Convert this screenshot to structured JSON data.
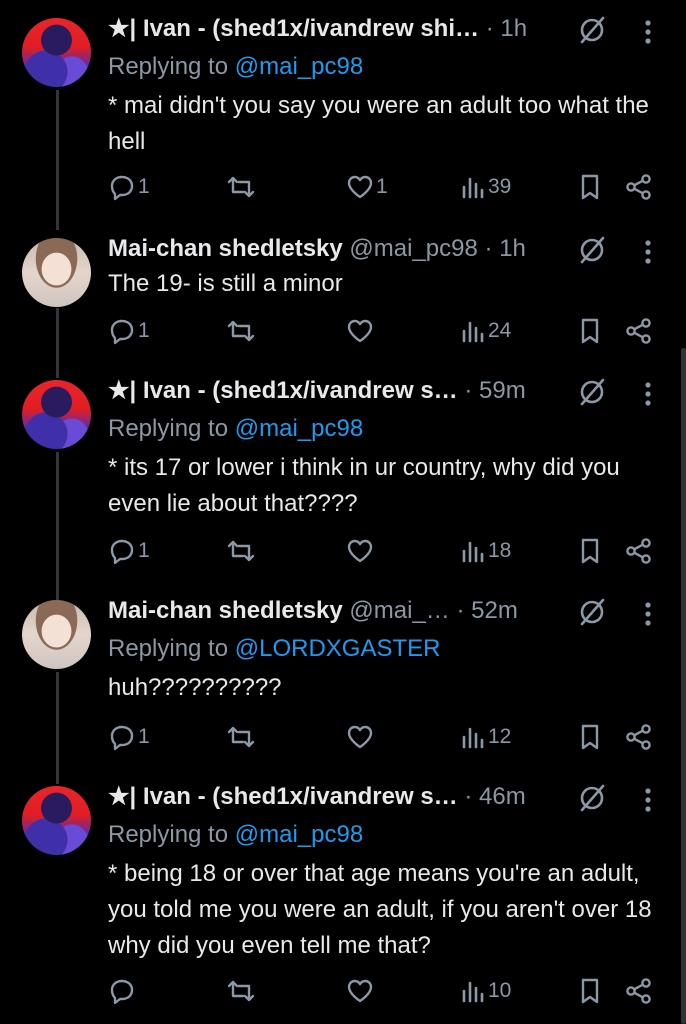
{
  "tweets": [
    {
      "avatar": "ivan-avatar",
      "name": "★| Ivan - (shed1x/ivandrew shi…",
      "handle": "",
      "time": "1h",
      "reply_prefix": "Replying to ",
      "reply_to": "@mai_pc98",
      "text": "* mai didn't you say you were an adult too what the hell",
      "replies": "1",
      "reposts": "",
      "likes": "1",
      "views": "39"
    },
    {
      "avatar": "mai-avatar",
      "name": "Mai-chan shedletsky",
      "handle": "@mai_pc98",
      "time": "1h",
      "reply_prefix": "",
      "reply_to": "",
      "text": "The 19- is still a minor",
      "replies": "1",
      "reposts": "",
      "likes": "",
      "views": "24"
    },
    {
      "avatar": "ivan-avatar",
      "name": "★| Ivan - (shed1x/ivandrew s…",
      "handle": "",
      "time": "59m",
      "reply_prefix": "Replying to ",
      "reply_to": "@mai_pc98",
      "text": "* its 17 or lower i think in ur country, why did you even lie about that????",
      "replies": "1",
      "reposts": "",
      "likes": "",
      "views": "18"
    },
    {
      "avatar": "mai-avatar",
      "name": "Mai-chan shedletsky",
      "handle": "@mai_…",
      "time": "52m",
      "reply_prefix": "Replying to ",
      "reply_to": "@LORDXGASTER",
      "text": "huh??????????",
      "replies": "1",
      "reposts": "",
      "likes": "",
      "views": "12"
    },
    {
      "avatar": "ivan-avatar",
      "name": "★| Ivan - (shed1x/ivandrew s…",
      "handle": "",
      "time": "46m",
      "reply_prefix": "Replying to ",
      "reply_to": "@mai_pc98",
      "text": "* being 18 or over that age means you're an adult, you told me you were an adult, if you aren't over 18 why did you even tell me that?",
      "replies": "",
      "reposts": "",
      "likes": "",
      "views": "10"
    }
  ],
  "separator": "·",
  "icons": {
    "reply": "reply-icon",
    "repost": "repost-icon",
    "like": "like-icon",
    "views": "views-icon",
    "bookmark": "bookmark-icon",
    "share": "share-icon",
    "grok": "grok-icon",
    "more": "more-icon"
  },
  "colors": {
    "background": "#000000",
    "text": "#e7e9ea",
    "muted": "#8b98a5",
    "mention": "#1d9bf0",
    "thread_line": "#333639"
  }
}
